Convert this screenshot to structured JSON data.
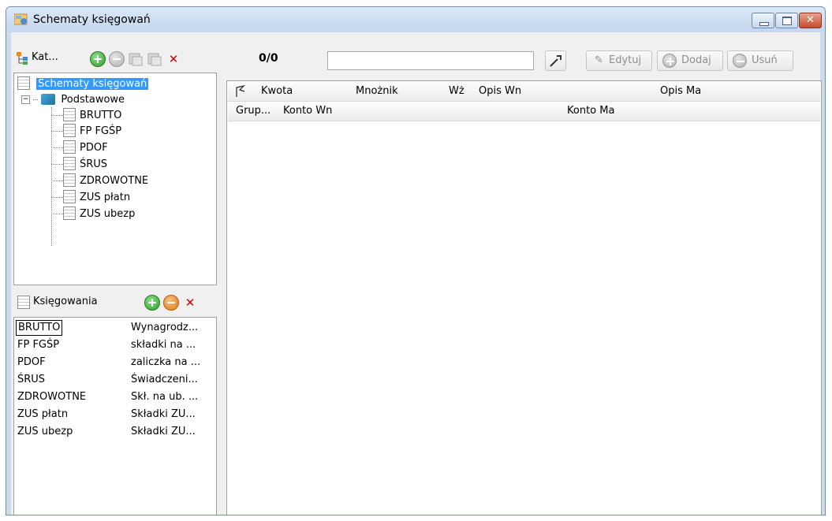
{
  "window": {
    "title": "Schematy księgowań",
    "icon": "schema-app-icon"
  },
  "katalog": {
    "label": "Kat...",
    "tree_root": "Schematy księgowań",
    "group": "Podstawowe",
    "items": [
      "BRUTTO",
      "FP FGŚP",
      "PDOF",
      "ŚRUS",
      "ZDROWOTNE",
      "ZUS płatn",
      "ZUS ubezp"
    ]
  },
  "ksiegowania": {
    "label": "Księgowania",
    "rows": [
      {
        "name": "BRUTTO",
        "desc": "Wynagrodz..."
      },
      {
        "name": "FP FGŚP",
        "desc": "składki na ..."
      },
      {
        "name": "PDOF",
        "desc": "zaliczka na ..."
      },
      {
        "name": "ŚRUS",
        "desc": "Świadczeni..."
      },
      {
        "name": "ZDROWOTNE",
        "desc": "Skł. na ub. ..."
      },
      {
        "name": "ZUS płatn",
        "desc": "Składki ZU..."
      },
      {
        "name": "ZUS ubezp",
        "desc": "Składki ZU..."
      }
    ]
  },
  "toolbar": {
    "counter": "0/0",
    "search_value": "",
    "edit_label": "Edytuj",
    "add_label": "Dodaj",
    "remove_label": "Usuń"
  },
  "grid": {
    "header1": [
      "Kwota",
      "Mnożnik",
      "Wż",
      "Opis Wn",
      "Opis Ma"
    ],
    "header2": [
      "Grup...",
      "Konto Wn",
      "Konto Ma"
    ]
  }
}
